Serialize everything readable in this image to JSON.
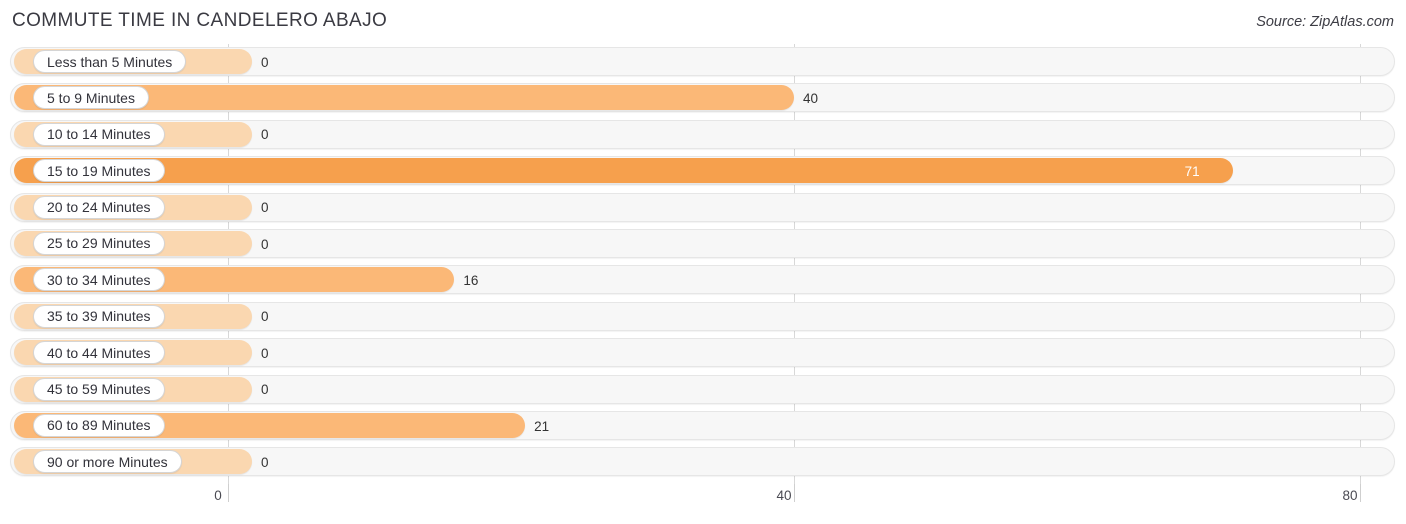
{
  "header": {
    "title": "COMMUTE TIME IN CANDELERO ABAJO",
    "source": "Source: ZipAtlas.com"
  },
  "colors": {
    "bar_zero": "#fad7b0",
    "bar_mid": "#fbb877",
    "bar_high": "#f6a04d",
    "track": "#f7f7f7",
    "grid": "#d8d8d8",
    "text": "#333333"
  },
  "chart_data": {
    "type": "bar",
    "orientation": "horizontal",
    "title": "COMMUTE TIME IN CANDELERO ABAJO",
    "xlabel": "",
    "ylabel": "",
    "xlim": [
      0,
      80
    ],
    "ticks": [
      0,
      40,
      80
    ],
    "grid": true,
    "legend": null,
    "categories": [
      "Less than 5 Minutes",
      "5 to 9 Minutes",
      "10 to 14 Minutes",
      "15 to 19 Minutes",
      "20 to 24 Minutes",
      "25 to 29 Minutes",
      "30 to 34 Minutes",
      "35 to 39 Minutes",
      "40 to 44 Minutes",
      "45 to 59 Minutes",
      "60 to 89 Minutes",
      "90 or more Minutes"
    ],
    "values": [
      0,
      40,
      0,
      71,
      0,
      0,
      16,
      0,
      0,
      0,
      21,
      0
    ],
    "value_labels": [
      "0",
      "40",
      "0",
      "71",
      "0",
      "0",
      "16",
      "0",
      "0",
      "0",
      "21",
      "0"
    ]
  },
  "axis": {
    "ticks": [
      {
        "label": "0",
        "value": 0
      },
      {
        "label": "40",
        "value": 40
      },
      {
        "label": "80",
        "value": 80
      }
    ]
  }
}
